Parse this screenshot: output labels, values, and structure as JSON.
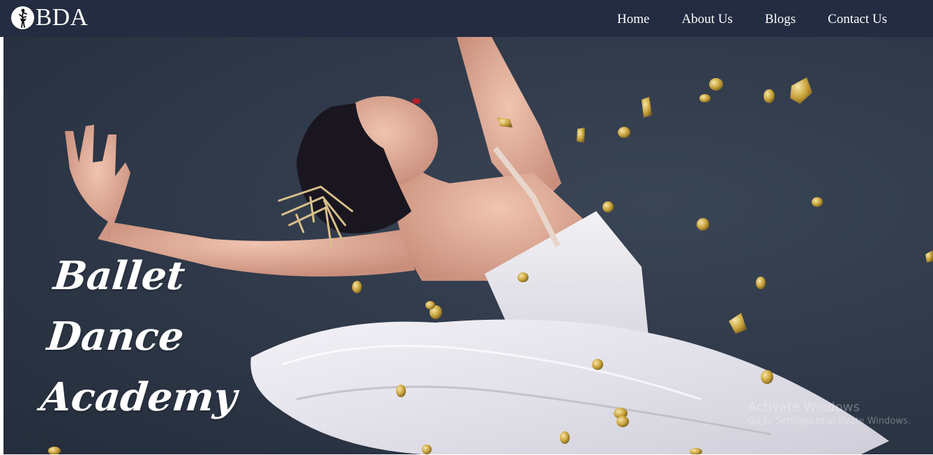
{
  "header": {
    "brand": {
      "logo_icon": "ballerina-logo-icon",
      "name": "BDA"
    },
    "nav": [
      {
        "label": "Home"
      },
      {
        "label": "About Us"
      },
      {
        "label": "Blogs"
      },
      {
        "label": "Contact Us"
      }
    ]
  },
  "hero": {
    "title_lines": [
      "Ballet",
      "Dance",
      "Academy"
    ],
    "image": "ballerina-leaping-with-gold-confetti"
  },
  "os_overlay": {
    "title": "Activate Windows",
    "subtitle": "Go to Settings to activate Windows."
  },
  "colors": {
    "navbar": "#232c40",
    "hero_background": "#2e3848",
    "confetti_gold": "#c9a23a",
    "tutu_white": "#e8e6ee"
  }
}
